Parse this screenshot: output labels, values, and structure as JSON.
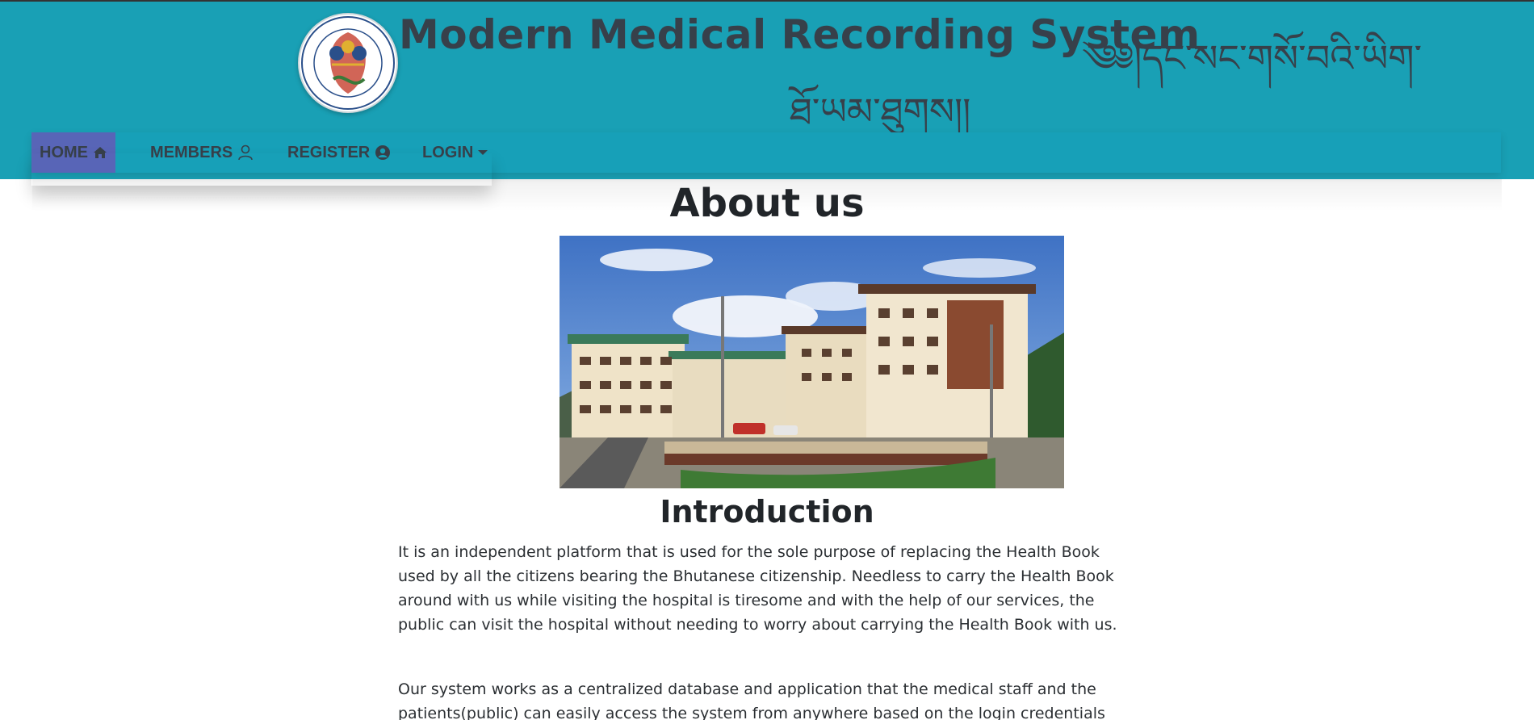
{
  "header": {
    "title": "Modern Medical Recording System",
    "dzongkha_line1": "༄༅།དང་སང་གསོ་བའི་ཡིག་",
    "dzongkha_line2": "ཐོ་ཡམ་ཐུགས།།",
    "logo_icon": "royal-emblem-logo",
    "colors": {
      "header_bg": "#19a0b5",
      "nav_active": "#5865b7",
      "text_dark": "#37404a"
    }
  },
  "nav": {
    "items": [
      {
        "label": "HOME",
        "icon": "home-icon",
        "active": true
      },
      {
        "label": "MEMBERS",
        "icon": "user-outline-icon"
      },
      {
        "label": "REGISTER",
        "icon": "user-circle-icon"
      },
      {
        "label": "LOGIN",
        "icon": "caret-down-icon"
      }
    ]
  },
  "main": {
    "heading": "About us",
    "image_icon": "hospital-building-photo",
    "subheading": "Introduction",
    "paragraphs": [
      "It is an independent platform that is used for the sole purpose of replacing the Health Book used by all the citizens bearing the Bhutanese citizenship. Needless to carry the Health Book around with us while visiting the hospital is tiresome and with the help of our services, the public can visit the hospital without needing to worry about carrying the Health Book with us.",
      "Our system works as a centralized database and application that the medical staff and the patients(public) can easily access the system from anywhere based on the login credentials while"
    ]
  }
}
